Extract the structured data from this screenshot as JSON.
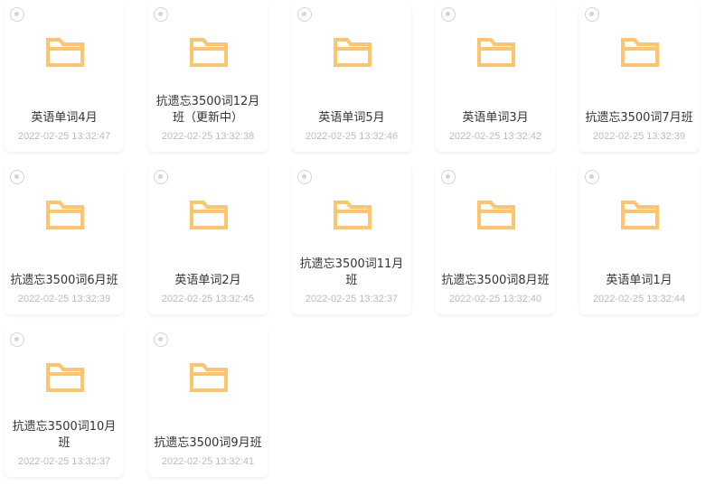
{
  "folder_color": "#FFC46E",
  "items": [
    {
      "name": "英语单词4月",
      "date": "2022-02-25 13:32:47",
      "icon": "folder-icon"
    },
    {
      "name": "抗遗忘3500词12月班（更新中）",
      "date": "2022-02-25 13:32:38",
      "icon": "folder-icon"
    },
    {
      "name": "英语单词5月",
      "date": "2022-02-25 13:32:46",
      "icon": "folder-icon"
    },
    {
      "name": "英语单词3月",
      "date": "2022-02-25 13:32:42",
      "icon": "folder-icon"
    },
    {
      "name": "抗遗忘3500词7月班",
      "date": "2022-02-25 13:32:39",
      "icon": "folder-icon"
    },
    {
      "name": "抗遗忘3500词6月班",
      "date": "2022-02-25 13:32:39",
      "icon": "folder-icon"
    },
    {
      "name": "英语单词2月",
      "date": "2022-02-25 13:32:45",
      "icon": "folder-icon"
    },
    {
      "name": "抗遗忘3500词11月班",
      "date": "2022-02-25 13:32:37",
      "icon": "folder-icon"
    },
    {
      "name": "抗遗忘3500词8月班",
      "date": "2022-02-25 13:32:40",
      "icon": "folder-icon"
    },
    {
      "name": "英语单词1月",
      "date": "2022-02-25 13:32:44",
      "icon": "folder-icon"
    },
    {
      "name": "抗遗忘3500词10月班",
      "date": "2022-02-25 13:32:37",
      "icon": "folder-icon"
    },
    {
      "name": "抗遗忘3500词9月班",
      "date": "2022-02-25 13:32:41",
      "icon": "folder-icon"
    }
  ]
}
